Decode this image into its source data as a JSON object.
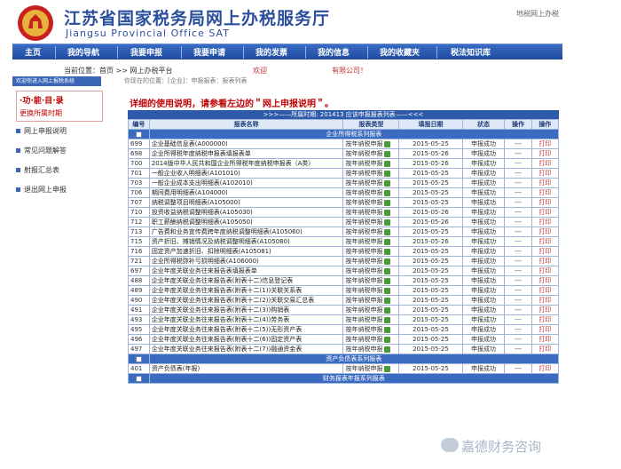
{
  "header": {
    "title": "江苏省国家税务局网上办税服务厅",
    "subtitle": "Jiangsu Provincial Office SAT",
    "top_link": "地税网上办税"
  },
  "nav": {
    "items": [
      "主页",
      "我的导航",
      "我要申报",
      "我要申请",
      "我的发票",
      "我的信息",
      "我的收藏夹",
      "税法知识库"
    ]
  },
  "breadcrumb": {
    "label": "当前位置：首页 >> 网上办税平台",
    "user": "欢迎",
    "company": "有限公司！"
  },
  "sidebar": {
    "header": "欢迎你进入网上报税系统",
    "group_title": "·功·能·目·录",
    "group_sub": "更换所属时期",
    "items": [
      "网上申报说明",
      "常见问题解答",
      "射报汇总表",
      "退出网上申报"
    ]
  },
  "main": {
    "location_hint": "你现在的位置：[企业]：申报报表：报表列表",
    "usage_hint": "详细的使用说明，请参看左边的＂网上申报说明＂。",
    "table_title": ">>>——所属时期: 201413 应该申报报表列表——<<<",
    "columns": [
      "编号",
      "报表名称",
      "报表类型",
      "填报日期",
      "状态",
      "操作",
      "操作"
    ],
    "group1": "企业所得税系列报表",
    "group2": "资产负债表系列报表",
    "group3": "财务报表年报系列报表",
    "rows": [
      {
        "code": "699",
        "name": "企业基础信息表(A000000)",
        "type": "按年纳税申报",
        "date": "2015-05-25",
        "status": "申报成功",
        "op": "---",
        "print": "打印"
      },
      {
        "code": "698",
        "name": "企业所得税年度纳税申报表填报表单",
        "type": "按年纳税申报",
        "date": "2015-05-26",
        "status": "申报成功",
        "op": "---",
        "print": "打印"
      },
      {
        "code": "700",
        "name": "2014版中华人民共和国企业所得税年度纳税申报表（A类）",
        "type": "按年纳税申报",
        "date": "2015-05-26",
        "status": "申报成功",
        "op": "---",
        "print": "打印"
      },
      {
        "code": "701",
        "name": "一般企业收入明细表(A101010)",
        "type": "按年纳税申报",
        "date": "2015-05-25",
        "status": "申报成功",
        "op": "---",
        "print": "打印"
      },
      {
        "code": "703",
        "name": "一般企业成本支出明细表(A102010)",
        "type": "按年纳税申报",
        "date": "2015-05-25",
        "status": "申报成功",
        "op": "---",
        "print": "打印"
      },
      {
        "code": "706",
        "name": "期间费用明细表(A104000)",
        "type": "按年纳税申报",
        "date": "2015-05-25",
        "status": "申报成功",
        "op": "---",
        "print": "打印"
      },
      {
        "code": "707",
        "name": "纳税调整项目明细表(A105000)",
        "type": "按年纳税申报",
        "date": "2015-05-25",
        "status": "申报成功",
        "op": "---",
        "print": "打印"
      },
      {
        "code": "710",
        "name": "投资收益纳税调整明细表(A105030)",
        "type": "按年纳税申报",
        "date": "2015-05-26",
        "status": "申报成功",
        "op": "---",
        "print": "打印"
      },
      {
        "code": "712",
        "name": "职工薪酬纳税调整明细表(A105050)",
        "type": "按年纳税申报",
        "date": "2015-05-26",
        "status": "申报成功",
        "op": "---",
        "print": "打印"
      },
      {
        "code": "713",
        "name": "广告费和业务宣传费跨年度纳税调整明细表(A105060)",
        "type": "按年纳税申报",
        "date": "2015-05-25",
        "status": "申报成功",
        "op": "---",
        "print": "打印"
      },
      {
        "code": "715",
        "name": "资产折旧、摊销情况及纳税调整明细表(A105080)",
        "type": "按年纳税申报",
        "date": "2015-05-26",
        "status": "申报成功",
        "op": "---",
        "print": "打印"
      },
      {
        "code": "716",
        "name": "固定资产加速折旧、扣除明细表(A105081)",
        "type": "按年纳税申报",
        "date": "2015-05-25",
        "status": "申报成功",
        "op": "---",
        "print": "打印"
      },
      {
        "code": "721",
        "name": "企业所得税弥补亏损明细表(A106000)",
        "type": "按年纳税申报",
        "date": "2015-05-25",
        "status": "申报成功",
        "op": "---",
        "print": "打印"
      },
      {
        "code": "697",
        "name": "企业年度关联业务往来报告表填报表单",
        "type": "按年纳税申报",
        "date": "2015-05-25",
        "status": "申报成功",
        "op": "---",
        "print": "打印"
      },
      {
        "code": "488",
        "name": "企业年度关联业务往来报告表(附表十二)信息登记表",
        "type": "按年纳税申报",
        "date": "2015-05-25",
        "status": "申报成功",
        "op": "---",
        "print": "打印"
      },
      {
        "code": "489",
        "name": "企业年度关联业务往来报告表(附表十二(1))关联关系表",
        "type": "按年纳税申报",
        "date": "2015-05-25",
        "status": "申报成功",
        "op": "---",
        "print": "打印"
      },
      {
        "code": "490",
        "name": "企业年度关联业务往来报告表(附表十二(2))关联交易汇总表",
        "type": "按年纳税申报",
        "date": "2015-05-25",
        "status": "申报成功",
        "op": "---",
        "print": "打印"
      },
      {
        "code": "491",
        "name": "企业年度关联业务往来报告表(附表十二(3))购销表",
        "type": "按年纳税申报",
        "date": "2015-05-25",
        "status": "申报成功",
        "op": "---",
        "print": "打印"
      },
      {
        "code": "493",
        "name": "企业年度关联业务往来报告表(附表十二(4))劳务表",
        "type": "按年纳税申报",
        "date": "2015-05-25",
        "status": "申报成功",
        "op": "---",
        "print": "打印"
      },
      {
        "code": "495",
        "name": "企业年度关联业务往来报告表(附表十二(5))无形资产表",
        "type": "按年纳税申报",
        "date": "2015-05-25",
        "status": "申报成功",
        "op": "---",
        "print": "打印"
      },
      {
        "code": "496",
        "name": "企业年度关联业务往来报告表(附表十二(6))固定资产表",
        "type": "按年纳税申报",
        "date": "2015-05-25",
        "status": "申报成功",
        "op": "---",
        "print": "打印"
      },
      {
        "code": "497",
        "name": "企业年度关联业务往来报告表(附表十二(7))融通资金表",
        "type": "按年纳税申报",
        "date": "2015-05-25",
        "status": "申报成功",
        "op": "---",
        "print": "打印"
      }
    ],
    "rows2": [
      {
        "code": "401",
        "name": "资产负债表(年报)",
        "type": "按年纳税申报",
        "date": "2015-05-25",
        "status": "申报成功",
        "op": "---",
        "print": "打印"
      }
    ]
  },
  "watermark": "嘉德财务咨询"
}
